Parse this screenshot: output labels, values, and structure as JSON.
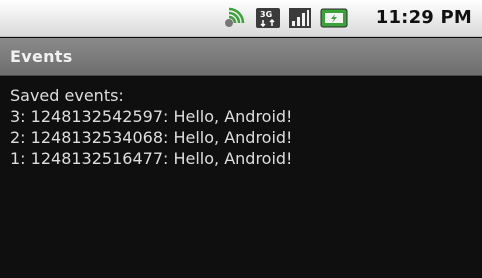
{
  "status_bar": {
    "time": "11:29 PM",
    "icons": [
      "sync-icon",
      "3g-icon",
      "signal-icon",
      "battery-icon"
    ],
    "accent_green": "#3aa33a"
  },
  "title_bar": {
    "title": "Events"
  },
  "content": {
    "heading": "Saved events:",
    "events": [
      "3: 1248132542597: Hello, Android!",
      "2: 1248132534068: Hello, Android!",
      "1: 1248132516477: Hello, Android!"
    ]
  }
}
